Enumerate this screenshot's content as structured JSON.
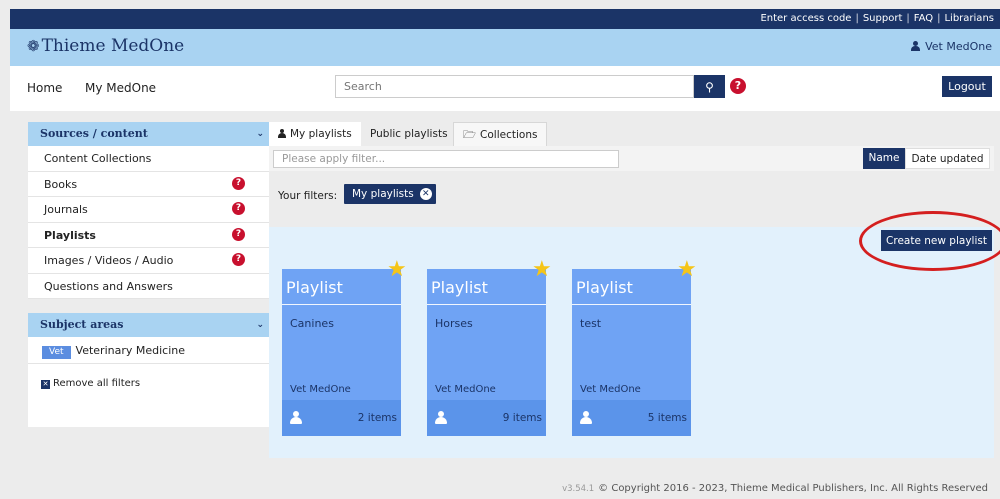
{
  "topbar": {
    "links": [
      "Enter access code",
      "Support",
      "FAQ",
      "Librarians"
    ]
  },
  "brand": {
    "name": "Thieme MedOne",
    "user": "Vet MedOne"
  },
  "nav": {
    "home": "Home",
    "my_medone": "My MedOne",
    "search_placeholder": "Search",
    "help": "?",
    "logout": "Logout"
  },
  "sidebar": {
    "sources_header": "Sources / content",
    "items": [
      {
        "label": "Content Collections",
        "help": false
      },
      {
        "label": "Books",
        "help": true
      },
      {
        "label": "Journals",
        "help": true
      },
      {
        "label": "Playlists",
        "help": true,
        "selected": true
      },
      {
        "label": "Images / Videos / Audio",
        "help": true
      },
      {
        "label": "Questions and Answers",
        "help": false
      }
    ],
    "subject_header": "Subject areas",
    "subject_badge": "Vet",
    "subject_label": "Veterinary Medicine",
    "remove_filters": "Remove all filters"
  },
  "tabs": {
    "my_playlists": "My playlists",
    "public_playlists": "Public playlists",
    "collections": "Collections"
  },
  "filterbar": {
    "placeholder": "Please apply filter...",
    "sort_name": "Name",
    "sort_date": "Date updated"
  },
  "filters": {
    "label": "Your filters:",
    "chip": "My playlists"
  },
  "create_button": "Create new playlist",
  "cards": [
    {
      "title": "Playlist",
      "name": "Canines",
      "owner": "Vet MedOne",
      "count": "2 items"
    },
    {
      "title": "Playlist",
      "name": "Horses",
      "owner": "Vet MedOne",
      "count": "9 items"
    },
    {
      "title": "Playlist",
      "name": "test",
      "owner": "Vet MedOne",
      "count": "5 items"
    }
  ],
  "footer": {
    "version": "v3.54.1",
    "copyright": "© Copyright 2016 - 2023, Thieme Medical Publishers, Inc. All Rights Reserved"
  },
  "colors": {
    "navy": "#1b3467",
    "light_blue": "#a9d3f2",
    "card_blue": "#6fa3f4",
    "help_red": "#c8102e",
    "annotation_red": "#d41f1f",
    "star": "#f5c518"
  }
}
